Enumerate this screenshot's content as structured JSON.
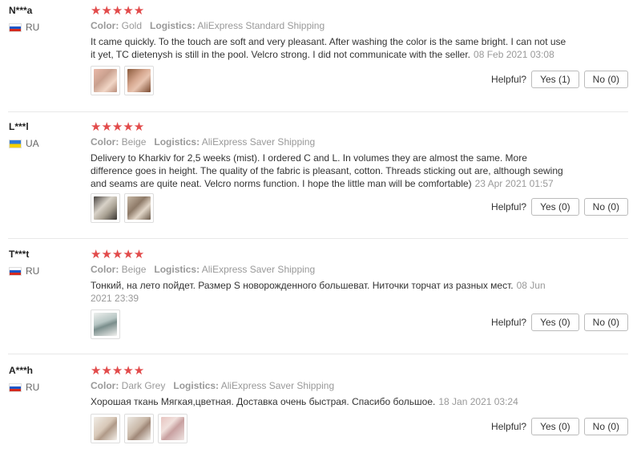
{
  "labels": {
    "color": "Color:",
    "logistics": "Logistics:",
    "helpful": "Helpful?"
  },
  "stars_glyph": "★★★★★",
  "reviews": [
    {
      "user": "N***a",
      "country": "RU",
      "flag": "ru",
      "rating": 5,
      "color": "Gold",
      "logistics": "AliExpress Standard Shipping",
      "text": "It came quickly. To the touch are soft and very pleasant. After washing the color is the same bright. I can not use it yet, TC dietenysh is still in the pool. Velcro strong. I did not communicate with the seller.",
      "date": "08 Feb 2021 03:08",
      "photos": 2,
      "yes": "Yes (1)",
      "no": "No (0)"
    },
    {
      "user": "L***l",
      "country": "UA",
      "flag": "ua",
      "rating": 5,
      "color": "Beige",
      "logistics": "AliExpress Saver Shipping",
      "text": "Delivery to Kharkiv for 2,5 weeks (mist). I ordered C and L. In volumes they are almost the same. More difference goes in height. The quality of the fabric is pleasant, cotton. Threads sticking out are, although sewing and seams are quite neat. Velcro norms function. I hope the little man will be comfortable)",
      "date": "23 Apr 2021 01:57",
      "photos": 2,
      "yes": "Yes (0)",
      "no": "No (0)"
    },
    {
      "user": "T***t",
      "country": "RU",
      "flag": "ru",
      "rating": 5,
      "color": "Beige",
      "logistics": "AliExpress Saver Shipping",
      "text": "Тонкий, на лето пойдет. Размер S новорожденного большеват. Ниточки торчат из разных мест.",
      "date": "08 Jun 2021 23:39",
      "photos": 1,
      "yes": "Yes (0)",
      "no": "No (0)"
    },
    {
      "user": "A***h",
      "country": "RU",
      "flag": "ru",
      "rating": 5,
      "color": "Dark Grey",
      "logistics": "AliExpress Saver Shipping",
      "text": "Хорошая ткань Мягкая,цветная. Доставка очень быстрая. Спасибо большое.",
      "date": "18 Jan 2021 03:24",
      "photos": 3,
      "yes": "Yes (0)",
      "no": "No (0)"
    }
  ],
  "colors": {
    "star": "#e24b4b",
    "muted": "#999999",
    "text": "#333333",
    "divider": "#e8e8e8"
  }
}
